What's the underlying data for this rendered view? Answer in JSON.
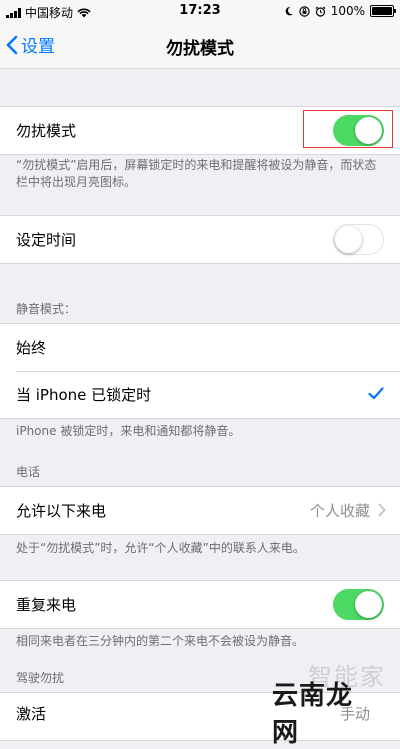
{
  "status_bar": {
    "carrier": "中国移动",
    "time": "17:23",
    "battery": "100%",
    "battery_level": 1.0
  },
  "nav": {
    "back_label": "设置",
    "title": "勿扰模式"
  },
  "dnd": {
    "label": "勿扰模式",
    "enabled": true,
    "footnote": "“勿扰模式”启用后，屏幕锁定时的来电和提醒将被设为静音，而状态栏中将出现月亮图标。"
  },
  "scheduled": {
    "label": "设定时间",
    "enabled": false
  },
  "silence": {
    "header": "静音模式：",
    "options": [
      {
        "label": "始终",
        "selected": false
      },
      {
        "label": "当 iPhone 已锁定时",
        "selected": true
      }
    ],
    "footnote": "iPhone 被锁定时，来电和通知都将静音。"
  },
  "phone": {
    "header": "电话",
    "allow_calls_label": "允许以下来电",
    "allow_calls_value": "个人收藏",
    "footnote": "处于“勿扰模式”时，允许“个人收藏”中的联系人来电。",
    "repeated_label": "重复来电",
    "repeated_enabled": true,
    "repeated_footnote": "相同来电者在三分钟内的第二个来电不会被设为静音。"
  },
  "driving": {
    "header": "驾驶勿扰",
    "activate_label": "激活",
    "activate_value": "手动"
  },
  "watermark": {
    "line1": "智能家",
    "line2": "云南龙网"
  },
  "colors": {
    "accent": "#007aff",
    "toggle_on": "#4cd964",
    "highlight": "#e53935",
    "background": "#efeff4"
  }
}
